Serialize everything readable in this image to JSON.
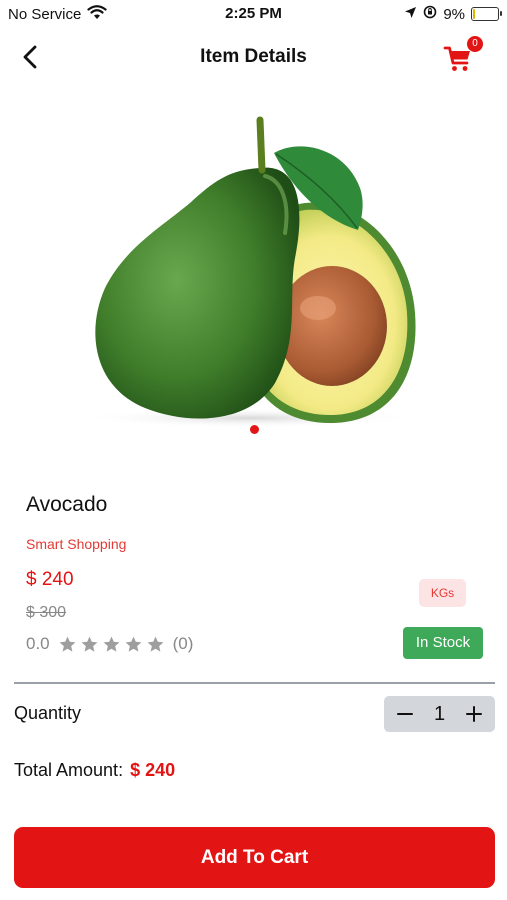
{
  "status_bar": {
    "carrier": "No Service",
    "time": "2:25 PM",
    "battery_percent": "9%",
    "battery_level": 0.09
  },
  "nav": {
    "title": "Item Details",
    "cart_count": "0"
  },
  "carousel": {
    "slide_count": 1,
    "active_index": 0
  },
  "product": {
    "name": "Avocado",
    "vendor": "Smart Shopping",
    "price": "$ 240",
    "old_price": "$ 300",
    "rating": "0.0",
    "rating_stars": 0,
    "review_count": "(0)",
    "unit": "KGs",
    "stock_status": "In Stock"
  },
  "quantity": {
    "label": "Quantity",
    "value": "1"
  },
  "total": {
    "label": "Total Amount:",
    "value": "$ 240"
  },
  "actions": {
    "add_to_cart": "Add To Cart"
  },
  "colors": {
    "accent": "#e31414",
    "stock_green": "#3fa95a",
    "star_gray": "#9e9e9e"
  }
}
